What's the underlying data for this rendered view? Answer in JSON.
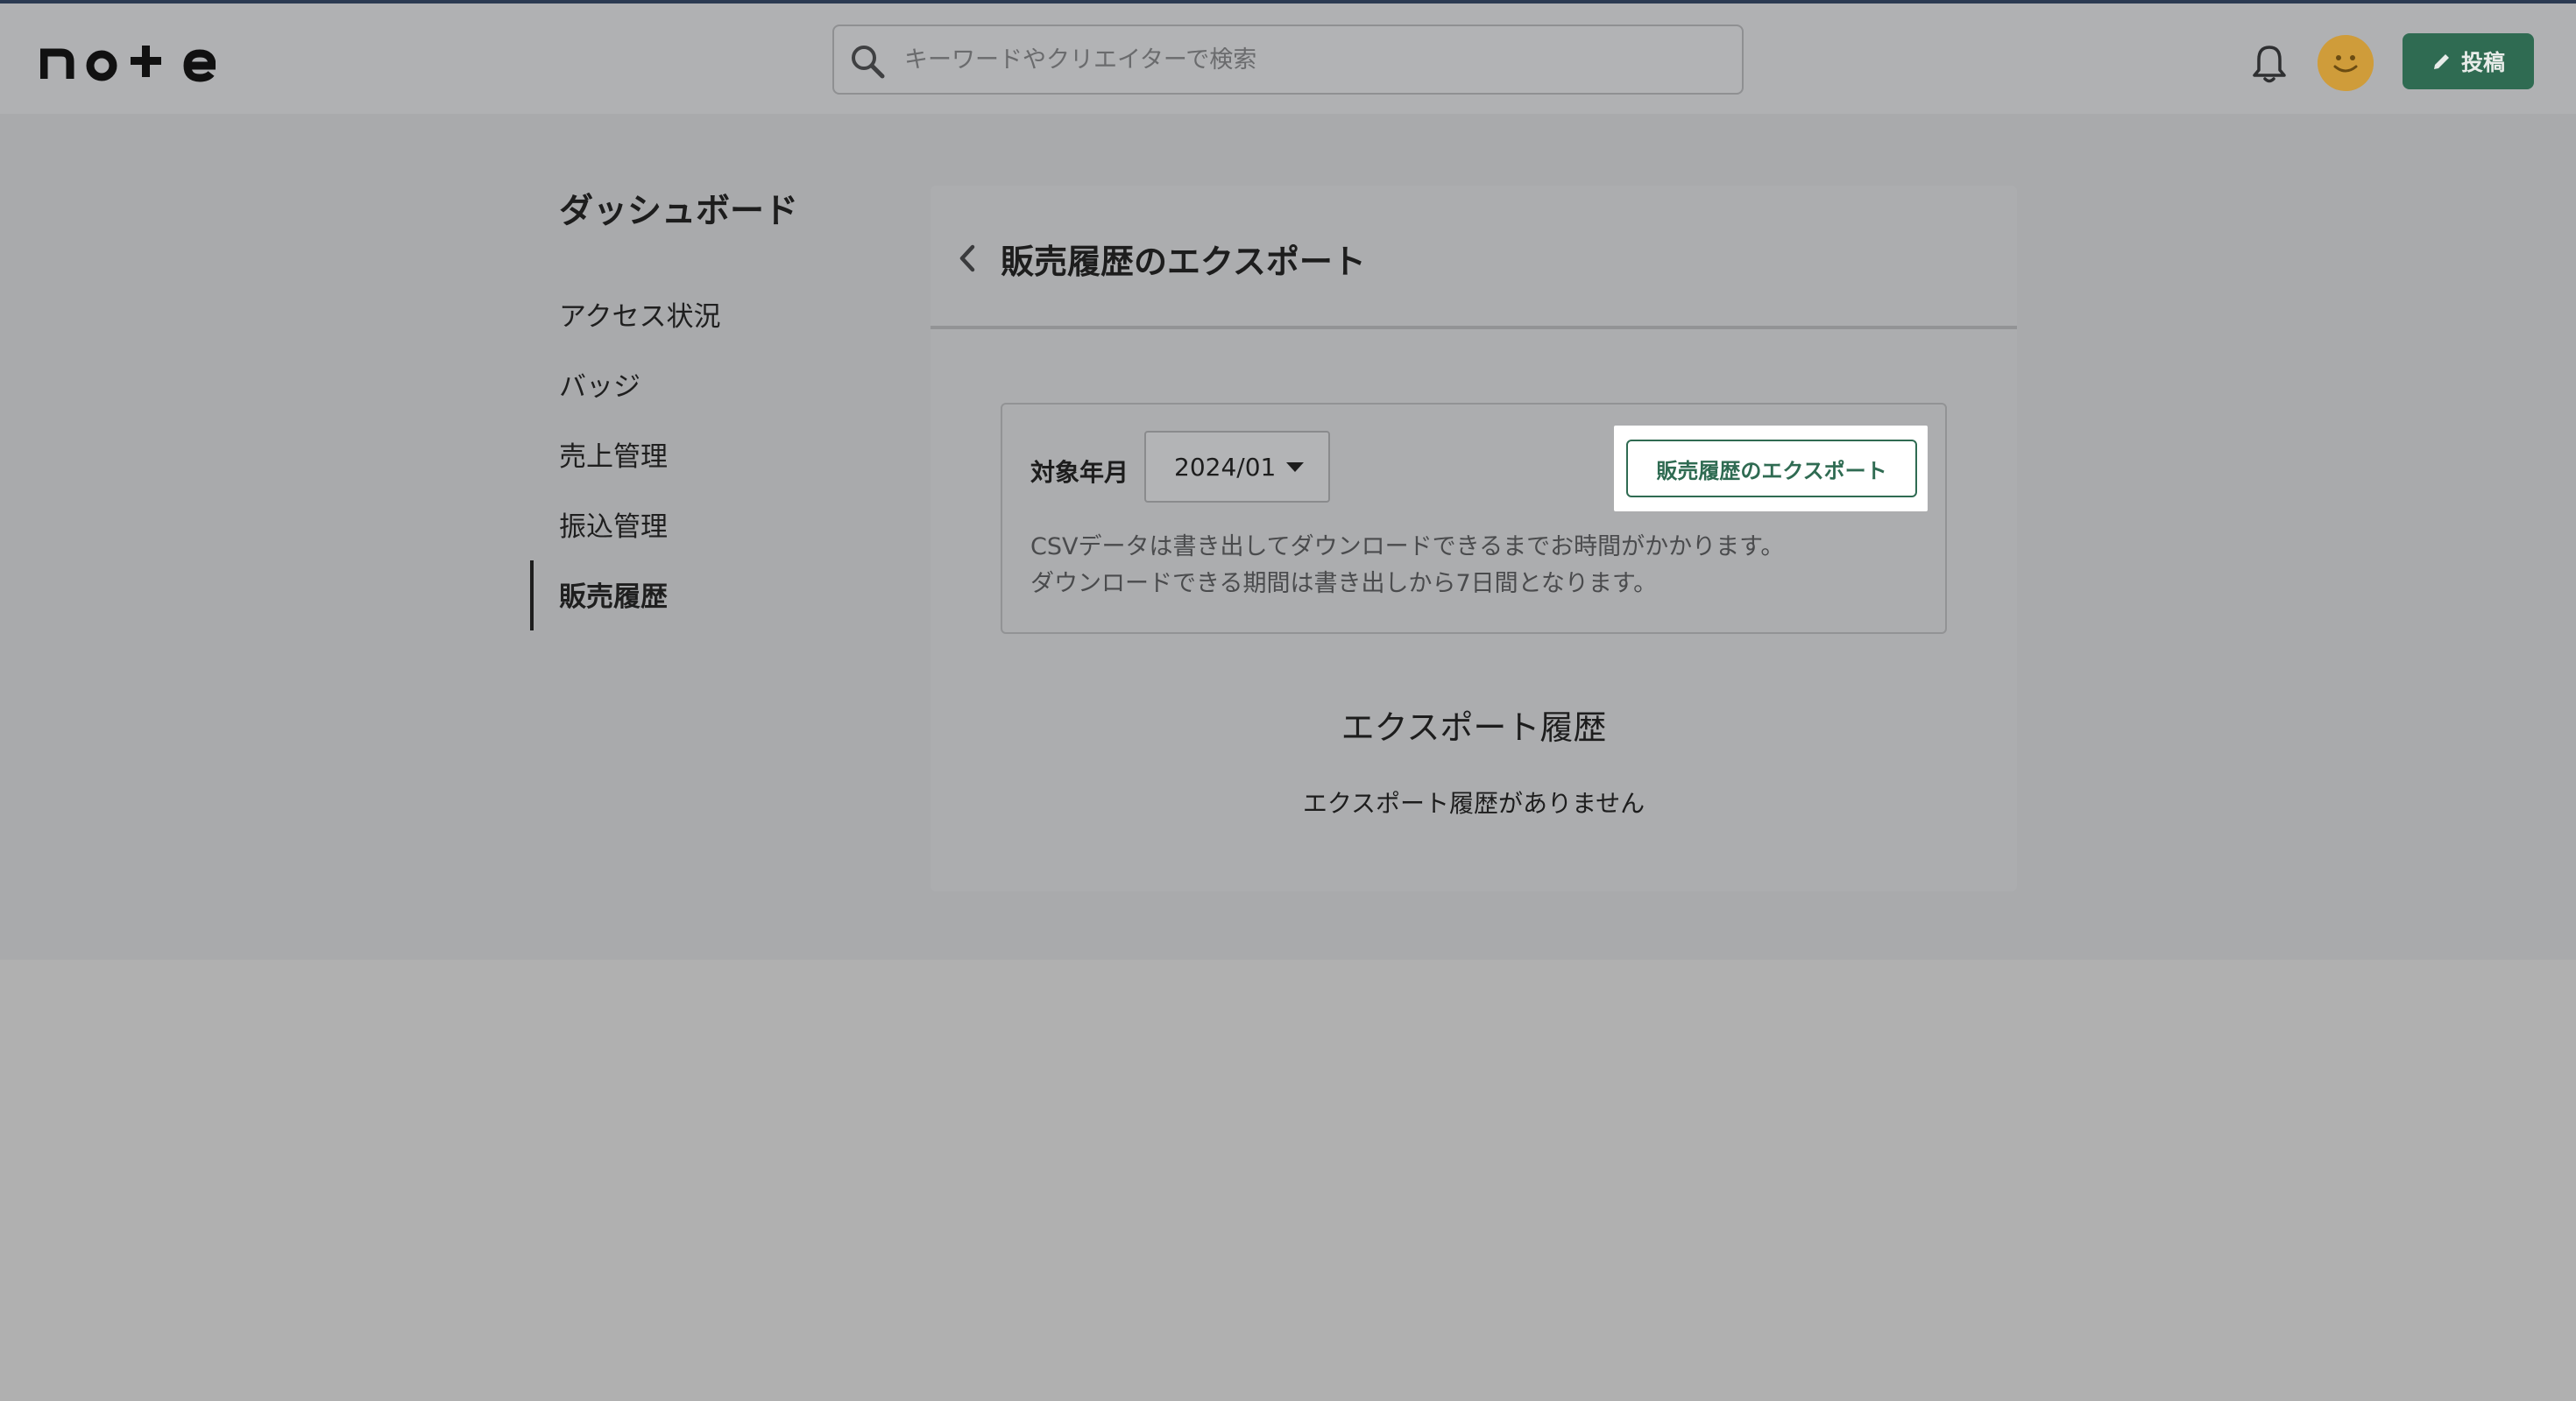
{
  "header": {
    "logo_text": "note",
    "search": {
      "placeholder": "キーワードやクリエイターで検索"
    },
    "post_button_label": "投稿",
    "icons": [
      "search-icon",
      "bell-icon",
      "avatar",
      "pencil-icon"
    ],
    "accent_color": "#2f6b52"
  },
  "sidebar": {
    "title": "ダッシュボード",
    "items": [
      {
        "label": "アクセス状況",
        "active": false
      },
      {
        "label": "バッジ",
        "active": false
      },
      {
        "label": "売上管理",
        "active": false
      },
      {
        "label": "振込管理",
        "active": false
      },
      {
        "label": "販売履歴",
        "active": true
      }
    ]
  },
  "main": {
    "title": "販売履歴のエクスポート",
    "export": {
      "month_label": "対象年月",
      "month_value": "2024/01",
      "export_button_label": "販売履歴のエクスポート",
      "notes": [
        "CSVデータは書き出してダウンロードできるまでお時間がかかります。",
        "ダウンロードできる期間は書き出しから7日間となります。"
      ]
    },
    "history": {
      "title": "エクスポート履歴",
      "empty_message": "エクスポート履歴がありません"
    }
  }
}
